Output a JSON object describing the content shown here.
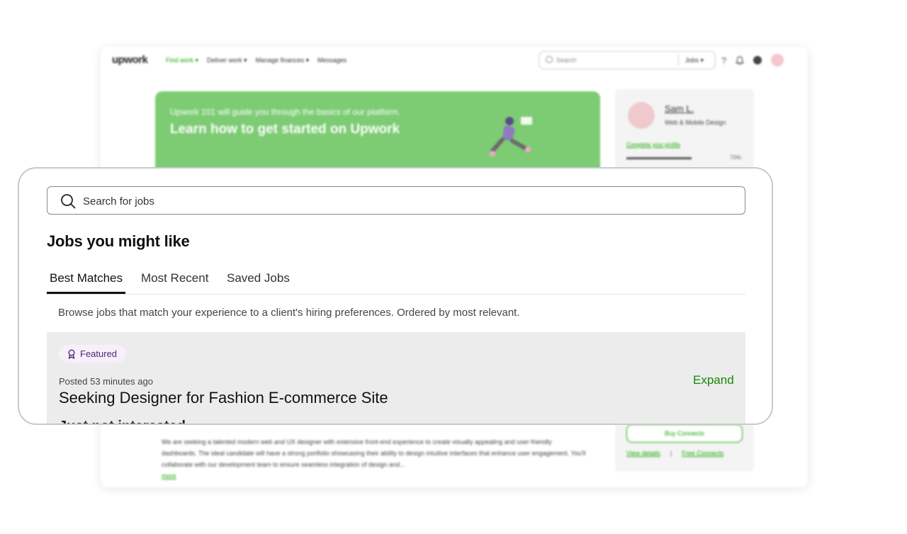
{
  "background_app": {
    "logo": "upwork",
    "nav": [
      "Find work ▾",
      "Deliver work ▾",
      "Manage finances ▾",
      "Messages"
    ],
    "search_placeholder": "Search",
    "search_scope": "Jobs ▾",
    "help_icon": "?",
    "banner": {
      "small_text": "Upwork 101 will guide you through the basics of our platform.",
      "title": "Learn how to get started on Upwork",
      "color": "#7dcc74"
    },
    "profile": {
      "name": "Sam L.",
      "role": "Web & Mobile Design",
      "complete_link": "Complete your profile",
      "completion": "70%",
      "buy_connects": "Buy Connects",
      "view_details": "View details",
      "separator": "|",
      "free_connects": "Free Connects"
    },
    "job_description": "We are seeking a talented modern web and UX designer with extensive front-end experience to create visually appealing and user-friendly dashboards. The ideal candidate will have a strong portfolio showcasing their ability to design intuitive interfaces that enhance user engagement. You'll collaborate with our development team to ensure seamless integration of design and...",
    "more_link": "more"
  },
  "panel": {
    "search_placeholder": "Search for jobs",
    "heading": "Jobs you might like",
    "tabs": [
      {
        "label": "Best Matches",
        "active": true
      },
      {
        "label": "Most Recent",
        "active": false
      },
      {
        "label": "Saved Jobs",
        "active": false
      }
    ],
    "subtitle": "Browse jobs that match your experience to a client's hiring preferences. Ordered by most relevant.",
    "job": {
      "badge": "Featured",
      "posted": "Posted 53 minutes ago",
      "title": "Seeking Designer for Fashion E-commerce Site",
      "expand": "Expand",
      "cut_off_text": "Just not interested"
    }
  },
  "colors": {
    "accent_green": "#14a800",
    "expand_green": "#108a00",
    "badge_bg": "#f7f0fb",
    "badge_text": "#4a2a74"
  }
}
